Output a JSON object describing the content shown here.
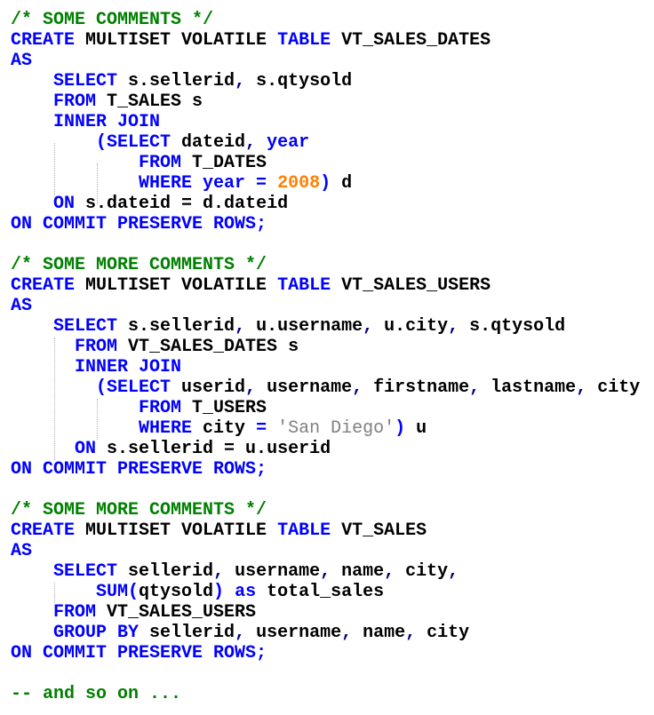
{
  "editor": {
    "language": "sql",
    "colors": {
      "keyword": "#0000ff",
      "comment": "#008000",
      "number": "#ff8000",
      "string": "#808080",
      "text": "#000000"
    },
    "lines": [
      [
        {
          "t": "cm",
          "v": "/* SOME COMMENTS */"
        }
      ],
      [
        {
          "t": "kw",
          "v": "CREATE"
        },
        {
          "t": "tx",
          "v": " MULTISET VOLATILE "
        },
        {
          "t": "kw",
          "v": "TABLE"
        },
        {
          "t": "tx",
          "v": " VT_SALES_DATES"
        }
      ],
      [
        {
          "t": "kw",
          "v": "AS"
        }
      ],
      [
        {
          "t": "tx",
          "v": "    "
        },
        {
          "t": "kw",
          "v": "SELECT"
        },
        {
          "t": "tx",
          "v": " s.sellerid"
        },
        {
          "t": "op",
          "v": ","
        },
        {
          "t": "tx",
          "v": " s.qtysold"
        }
      ],
      [
        {
          "t": "tx",
          "v": "    "
        },
        {
          "t": "kw",
          "v": "FROM"
        },
        {
          "t": "tx",
          "v": " T_SALES s"
        }
      ],
      [
        {
          "t": "tx",
          "v": "    "
        },
        {
          "t": "kw",
          "v": "INNER JOIN"
        }
      ],
      [
        {
          "t": "tx",
          "v": "        "
        },
        {
          "t": "kw",
          "v": "(SELECT"
        },
        {
          "t": "tx",
          "v": " dateid"
        },
        {
          "t": "op",
          "v": ","
        },
        {
          "t": "tx",
          "v": " "
        },
        {
          "t": "kw",
          "v": "year"
        }
      ],
      [
        {
          "t": "tx",
          "v": "            "
        },
        {
          "t": "kw",
          "v": "FROM"
        },
        {
          "t": "tx",
          "v": " T_DATES"
        }
      ],
      [
        {
          "t": "tx",
          "v": "            "
        },
        {
          "t": "kw",
          "v": "WHERE year ="
        },
        {
          "t": "tx",
          "v": " "
        },
        {
          "t": "num",
          "v": "2008"
        },
        {
          "t": "kw",
          "v": ")"
        },
        {
          "t": "tx",
          "v": " d"
        }
      ],
      [
        {
          "t": "tx",
          "v": "    "
        },
        {
          "t": "kw",
          "v": "ON"
        },
        {
          "t": "tx",
          "v": " s.dateid = d.dateid"
        }
      ],
      [
        {
          "t": "kw",
          "v": "ON COMMIT PRESERVE ROWS;"
        }
      ],
      [],
      [
        {
          "t": "cm",
          "v": "/* SOME MORE COMMENTS */"
        }
      ],
      [
        {
          "t": "kw",
          "v": "CREATE"
        },
        {
          "t": "tx",
          "v": " MULTISET VOLATILE "
        },
        {
          "t": "kw",
          "v": "TABLE"
        },
        {
          "t": "tx",
          "v": " VT_SALES_USERS"
        }
      ],
      [
        {
          "t": "kw",
          "v": "AS"
        }
      ],
      [
        {
          "t": "tx",
          "v": "    "
        },
        {
          "t": "kw",
          "v": "SELECT"
        },
        {
          "t": "tx",
          "v": " s.sellerid"
        },
        {
          "t": "op",
          "v": ","
        },
        {
          "t": "tx",
          "v": " u.username"
        },
        {
          "t": "op",
          "v": ","
        },
        {
          "t": "tx",
          "v": " u.city"
        },
        {
          "t": "op",
          "v": ","
        },
        {
          "t": "tx",
          "v": " s.qtysold"
        }
      ],
      [
        {
          "t": "tx",
          "v": "      "
        },
        {
          "t": "kw",
          "v": "FROM"
        },
        {
          "t": "tx",
          "v": " VT_SALES_DATES s"
        }
      ],
      [
        {
          "t": "tx",
          "v": "      "
        },
        {
          "t": "kw",
          "v": "INNER JOIN"
        }
      ],
      [
        {
          "t": "tx",
          "v": "        "
        },
        {
          "t": "kw",
          "v": "(SELECT"
        },
        {
          "t": "tx",
          "v": " userid"
        },
        {
          "t": "op",
          "v": ","
        },
        {
          "t": "tx",
          "v": " username"
        },
        {
          "t": "op",
          "v": ","
        },
        {
          "t": "tx",
          "v": " firstname"
        },
        {
          "t": "op",
          "v": ","
        },
        {
          "t": "tx",
          "v": " lastname"
        },
        {
          "t": "op",
          "v": ","
        },
        {
          "t": "tx",
          "v": " city"
        }
      ],
      [
        {
          "t": "tx",
          "v": "            "
        },
        {
          "t": "kw",
          "v": "FROM"
        },
        {
          "t": "tx",
          "v": " T_USERS"
        }
      ],
      [
        {
          "t": "tx",
          "v": "            "
        },
        {
          "t": "kw",
          "v": "WHERE"
        },
        {
          "t": "tx",
          "v": " city "
        },
        {
          "t": "kw",
          "v": "="
        },
        {
          "t": "tx",
          "v": " "
        },
        {
          "t": "str",
          "v": "'San Diego'"
        },
        {
          "t": "kw",
          "v": ")"
        },
        {
          "t": "tx",
          "v": " u"
        }
      ],
      [
        {
          "t": "tx",
          "v": "      "
        },
        {
          "t": "kw",
          "v": "ON"
        },
        {
          "t": "tx",
          "v": " s.sellerid = u.userid"
        }
      ],
      [
        {
          "t": "kw",
          "v": "ON COMMIT PRESERVE ROWS;"
        }
      ],
      [],
      [
        {
          "t": "cm",
          "v": "/* SOME MORE COMMENTS */"
        }
      ],
      [
        {
          "t": "kw",
          "v": "CREATE"
        },
        {
          "t": "tx",
          "v": " MULTISET VOLATILE "
        },
        {
          "t": "kw",
          "v": "TABLE"
        },
        {
          "t": "tx",
          "v": " VT_SALES"
        }
      ],
      [
        {
          "t": "kw",
          "v": "AS"
        }
      ],
      [
        {
          "t": "tx",
          "v": "    "
        },
        {
          "t": "kw",
          "v": "SELECT"
        },
        {
          "t": "tx",
          "v": " sellerid"
        },
        {
          "t": "op",
          "v": ","
        },
        {
          "t": "tx",
          "v": " username"
        },
        {
          "t": "op",
          "v": ","
        },
        {
          "t": "tx",
          "v": " name"
        },
        {
          "t": "op",
          "v": ","
        },
        {
          "t": "tx",
          "v": " city"
        },
        {
          "t": "op",
          "v": ","
        }
      ],
      [
        {
          "t": "tx",
          "v": "        "
        },
        {
          "t": "kw",
          "v": "SUM("
        },
        {
          "t": "tx",
          "v": "qtysold"
        },
        {
          "t": "kw",
          "v": ")"
        },
        {
          "t": "tx",
          "v": " "
        },
        {
          "t": "kw",
          "v": "as"
        },
        {
          "t": "tx",
          "v": " total_sales"
        }
      ],
      [
        {
          "t": "tx",
          "v": "    "
        },
        {
          "t": "kw",
          "v": "FROM"
        },
        {
          "t": "tx",
          "v": " VT_SALES_USERS"
        }
      ],
      [
        {
          "t": "tx",
          "v": "    "
        },
        {
          "t": "kw",
          "v": "GROUP BY"
        },
        {
          "t": "tx",
          "v": " sellerid"
        },
        {
          "t": "op",
          "v": ","
        },
        {
          "t": "tx",
          "v": " username"
        },
        {
          "t": "op",
          "v": ","
        },
        {
          "t": "tx",
          "v": " name"
        },
        {
          "t": "op",
          "v": ","
        },
        {
          "t": "tx",
          "v": " city"
        }
      ],
      [
        {
          "t": "kw",
          "v": "ON COMMIT PRESERVE ROWS;"
        }
      ],
      [],
      [
        {
          "t": "cm",
          "v": "-- and so on ..."
        }
      ]
    ]
  }
}
